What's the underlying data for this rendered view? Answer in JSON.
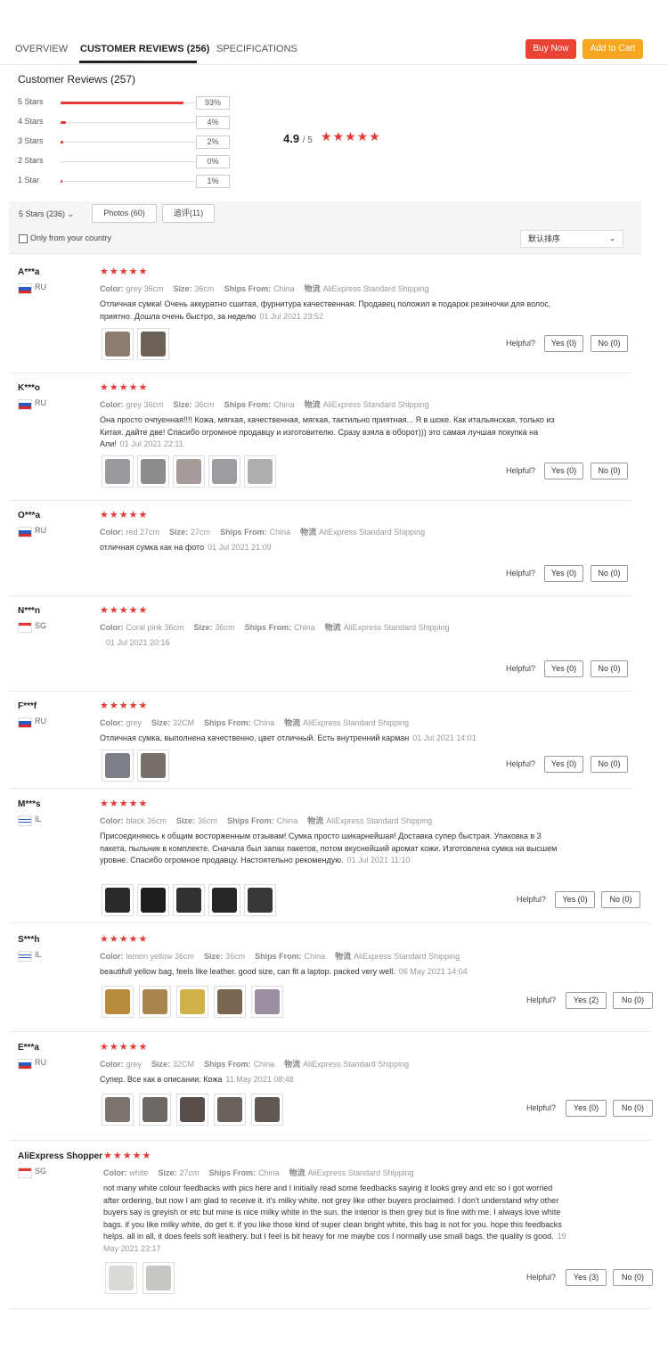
{
  "tabs": [
    {
      "label": "OVERVIEW"
    },
    {
      "label": "CUSTOMER REVIEWS (256)"
    },
    {
      "label": "SPECIFICATIONS"
    }
  ],
  "buttons": {
    "buy_now": "Buy Now",
    "add_to_cart": "Add to Cart"
  },
  "summary": {
    "title": "Customer Reviews (257)",
    "rows": [
      {
        "label": "5 Stars",
        "percent": "93%",
        "fill": 0.93
      },
      {
        "label": "4 Stars",
        "percent": "4%",
        "fill": 0.04
      },
      {
        "label": "3 Stars",
        "percent": "2%",
        "fill": 0.02
      },
      {
        "label": "2 Stars",
        "percent": "0%",
        "fill": 0.0
      },
      {
        "label": "1 Star",
        "percent": "1%",
        "fill": 0.01
      }
    ],
    "average": "4.9",
    "average_den": "/ 5",
    "average_stars": "★★★★★"
  },
  "filters": {
    "star_select": "5 Stars (236)",
    "star_caret": "⌄",
    "photos": "Photos (60)",
    "additional": "追评(11)",
    "country_checkbox": "Only from your country",
    "sort": "默认排序",
    "sort_caret": "⌄"
  },
  "labels": {
    "color": "Color:",
    "size": "Size:",
    "ships_from": "Ships From:",
    "shipping": "物流",
    "helpful": "Helpful?"
  },
  "reviews": [
    {
      "name": "A***a",
      "country": "RU",
      "stars": "★★★★★",
      "color": "grey 36cm",
      "size": "36cm",
      "ships_from": "China",
      "shipping": "AliExpress Standard Shipping",
      "text": "Отличная сумка! Очень аккуратно сшитая, фурнитура качественная. Продавец положил в подарок резиночки для волос, приятно. Дошла очень быстро, за неделю",
      "date": "01 Jul 2021 23:52",
      "yes": "Yes (0)",
      "no": "No (0)",
      "photos": [
        "#8a7d6d",
        "#6d6258"
      ]
    },
    {
      "name": "K***o",
      "country": "RU",
      "stars": "★★★★★",
      "color": "grey 36cm",
      "size": "36cm",
      "ships_from": "China",
      "shipping": "AliExpress Standard Shipping",
      "text": "Она просто очпуенная!!!! Кожа, мягкая, качественная, мягкая, тактильно приятная... Я в шоке. Как итальянская, только из Китая. дайте две! Спасибо огромное продавцу и изготовителю. Сразу взяла в оборот))) это самая лучшая покупка на Али!",
      "date": "01 Jul 2021 22:11",
      "yes": "Yes (0)",
      "no": "No (0)",
      "photos": [
        "#9a9a9e",
        "#8c8b8e",
        "#a59c9a",
        "#9d9ca0",
        "#b1aeb0"
      ]
    },
    {
      "name": "O***a",
      "country": "RU",
      "stars": "★★★★★",
      "color": "red 27cm",
      "size": "27cm",
      "ships_from": "China",
      "shipping": "AliExpress Standard Shipping",
      "text": "отличная сумка как на фото",
      "date": "01 Jul 2021 21:09",
      "yes": "Yes (0)",
      "no": "No (0)",
      "photos": []
    },
    {
      "name": "N***n",
      "country": "SG",
      "stars": "★★★★★",
      "color": "Coral pink 36cm",
      "size": "36cm",
      "ships_from": "China",
      "shipping": "AliExpress Standard Shipping",
      "text": "",
      "date": "01 Jul 2021 20:16",
      "yes": "Yes (0)",
      "no": "No (0)",
      "photos": []
    },
    {
      "name": "F***f",
      "country": "RU",
      "stars": "★★★★★",
      "color": "grey",
      "size": "32CM",
      "ships_from": "China",
      "shipping": "AliExpress Standard Shipping",
      "text": "Отличная сумка, выполнена качественно, цвет отличный. Есть внутренний карман",
      "date": "01 Jul 2021 14:01",
      "yes": "Yes (0)",
      "no": "No (0)",
      "photos": [
        "#7d7f86",
        "#77716a"
      ]
    },
    {
      "name": "M***s",
      "country": "IL",
      "stars": "★★★★★",
      "color": "black 36cm",
      "size": "36cm",
      "ships_from": "China",
      "shipping": "AliExpress Standard Shipping",
      "text": "Присоединяюсь к общим восторженным отзывам! Сумка просто шикарнейшая! Доставка супер быстрая. Упаковка в 3 пакета, пыльник в комплекте. Сначала был запах пакетов, потом вкуснейший аромат кожи. Изготовлена сумка на высшем уровне. Спасибо огромное продавцу. Настоятельно рекомендую.",
      "date": "01 Jul 2021 11:10",
      "yes": "Yes (0)",
      "no": "No (0)",
      "photos": [
        "#2a2a2a",
        "#1e1e1e",
        "#333030",
        "#262626",
        "#3a3737"
      ]
    },
    {
      "name": "S***h",
      "country": "IL",
      "stars": "★★★★★",
      "color": "lemon yellow 36cm",
      "size": "36cm",
      "ships_from": "China",
      "shipping": "AliExpress Standard Shipping",
      "text": "beautifull yellow bag, feels like leather. good size, can fit a laptop. packed very well.",
      "date": "06 May 2021 14:04",
      "yes": "Yes (2)",
      "no": "No (0)",
      "photos": [
        "#b88a3c",
        "#a8844f",
        "#d2b048",
        "#7a6650",
        "#9b8fa0"
      ]
    },
    {
      "name": "E***a",
      "country": "RU",
      "stars": "★★★★★",
      "color": "grey",
      "size": "32CM",
      "ships_from": "China",
      "shipping": "AliExpress Standard Shipping",
      "text": "Супер. Все как в описании. Кожа",
      "date": "11 May 2021 08:48",
      "yes": "Yes (0)",
      "no": "No (0)",
      "photos": [
        "#7b736d",
        "#6e6864",
        "#5a4e4a",
        "#6a635d",
        "#5f5752"
      ]
    },
    {
      "name": "AliExpress Shopper",
      "country": "SG",
      "stars": "★★★★★",
      "color": "white",
      "size": "27cm",
      "ships_from": "China",
      "shipping": "AliExpress Standard Shipping",
      "text": "not many white colour feedbacks with pics here and I initially read some feedbacks saying it looks grey and etc so I got worried after ordering, but now I am glad to receive it. it's milky white. not grey like other buyers proclaimed. I don't understand why other buyers say is greyish or etc but mine is nice milky white in the sun. the interior is then grey but is fine with me. I always love white bags. if you like milky white, do get it. if you like those kind of super clean bright white, this bag is not for you. hope this feedbacks helps. all in all, it does feels soft leathery. but I feel is bit heavy for me maybe cos I normally use small bags. the quality is good.",
      "date": "19 May 2021 23:17",
      "yes": "Yes (3)",
      "no": "No (0)",
      "photos": [
        "#dcdad7",
        "#c9c7c3"
      ]
    }
  ]
}
